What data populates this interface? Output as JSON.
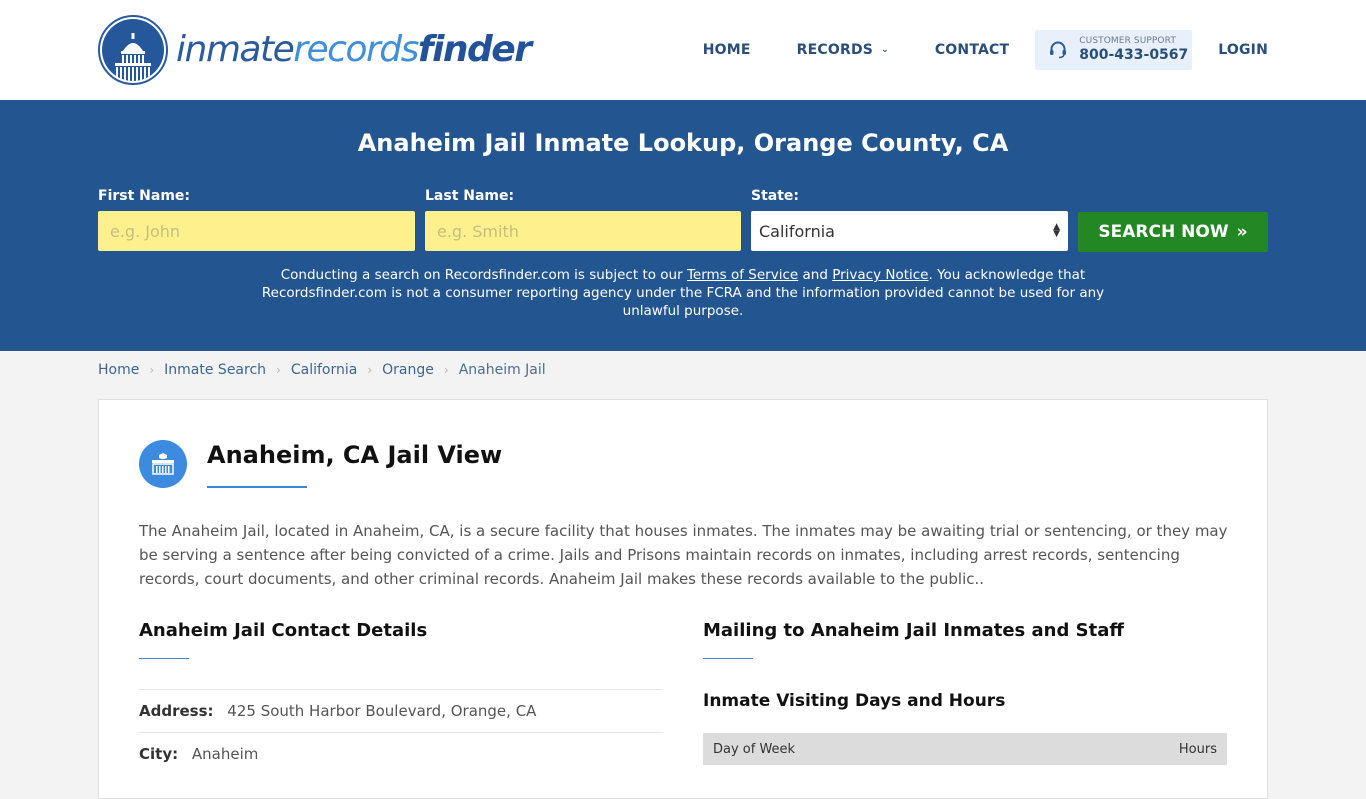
{
  "header": {
    "logo": {
      "part1": "inmate",
      "part2": "records",
      "part3": "finder"
    },
    "nav": {
      "home": "HOME",
      "records": "RECORDS",
      "contact": "CONTACT",
      "support_label": "CUSTOMER SUPPORT",
      "support_phone": "800-433-0567",
      "login": "LOGIN"
    }
  },
  "hero": {
    "title": "Anaheim Jail Inmate Lookup, Orange County, CA",
    "first_name_label": "First Name:",
    "first_name_placeholder": "e.g. John",
    "first_name_value": "",
    "last_name_label": "Last Name:",
    "last_name_placeholder": "e.g. Smith",
    "last_name_value": "",
    "state_label": "State:",
    "state_value": "California",
    "search_button": "SEARCH NOW",
    "disclaimer": {
      "pre": "Conducting a search on Recordsfinder.com is subject to our ",
      "tos": "Terms of Service",
      "and": " and ",
      "privacy": "Privacy Notice",
      "post": ". You acknowledge that Recordsfinder.com is not a consumer reporting agency under the FCRA and the information provided cannot be used for any unlawful purpose."
    }
  },
  "breadcrumb": [
    "Home",
    "Inmate Search",
    "California",
    "Orange",
    "Anaheim Jail"
  ],
  "main": {
    "title": "Anaheim, CA Jail View",
    "intro": "The Anaheim Jail, located in Anaheim, CA, is a secure facility that houses inmates. The inmates may be awaiting trial or sentencing, or they may be serving a sentence after being convicted of a crime. Jails and Prisons maintain records on inmates, including arrest records, sentencing records, court documents, and other criminal records. Anaheim Jail makes these records available to the public..",
    "contact": {
      "heading": "Anaheim Jail Contact Details",
      "address_label": "Address:",
      "address_value": "425 South Harbor Boulevard, Orange, CA",
      "city_label": "City:",
      "city_value": "Anaheim"
    },
    "mailing": {
      "heading": "Mailing to Anaheim Jail Inmates and Staff",
      "visiting_heading": "Inmate Visiting Days and Hours",
      "table_headers": [
        "Day of Week",
        "Hours"
      ]
    }
  },
  "colors": {
    "brand_blue": "#235590",
    "search_green": "#238723",
    "input_yellow": "#fff08e",
    "accent_blue": "#3d86d6"
  }
}
